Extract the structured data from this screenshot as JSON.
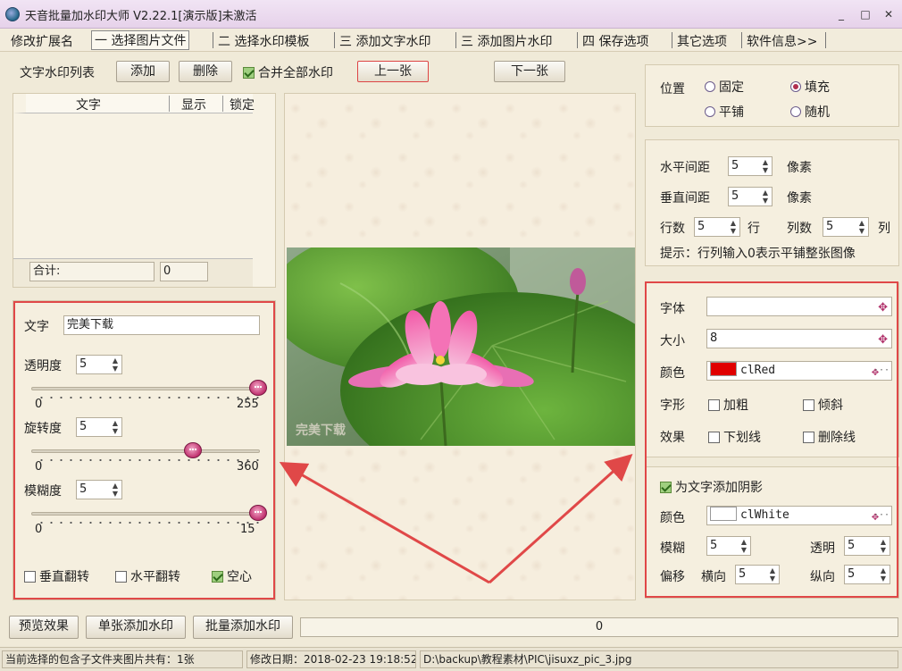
{
  "window": {
    "title": "天音批量加水印大师 V2.22.1[演示版]未激活",
    "controls": [
      "_",
      "□",
      "✕"
    ]
  },
  "menu": {
    "items": [
      "修改扩展名",
      "一 选择图片文件",
      "二 选择水印模板",
      "三 添加文字水印",
      "三 添加图片水印",
      "四 保存选项",
      "其它选项",
      "软件信息>>"
    ],
    "active_index": 1
  },
  "toolbar": {
    "list_label": "文字水印列表",
    "add": "添加",
    "delete": "删除",
    "merge_label": "合并全部水印",
    "prev": "上一张",
    "next": "下一张"
  },
  "list_table": {
    "headers": [
      "文字",
      "显示",
      "锁定"
    ],
    "total_label": "合计:",
    "total_value": "0"
  },
  "text_props": {
    "text_label": "文字",
    "text_value": "完美下载",
    "opacity_label": "透明度",
    "opacity_value": "5",
    "opacity_min": "0",
    "opacity_max": "255",
    "opacity_fraction": 1.0,
    "rotation_label": "旋转度",
    "rotation_value": "5",
    "rotation_min": "0",
    "rotation_max": "360",
    "rotation_fraction": 0.7,
    "blur_label": "模糊度",
    "blur_value": "5",
    "blur_min": "0",
    "blur_max": "15",
    "blur_fraction": 1.0,
    "flip_v": "垂直翻转",
    "flip_h": "水平翻转",
    "hollow": "空心"
  },
  "preview": {
    "watermark_text": "完美下载"
  },
  "position": {
    "label": "位置",
    "fixed": "固定",
    "fill": "填充",
    "tile": "平铺",
    "random": "随机",
    "selected": "fill"
  },
  "spacing": {
    "h_label": "水平间距",
    "h_value": "5",
    "v_label": "垂直间距",
    "v_value": "5",
    "unit": "像素",
    "rows_label": "行数",
    "rows_value": "5",
    "rows_unit": "行",
    "cols_label": "列数",
    "cols_value": "5",
    "cols_unit": "列",
    "hint": "提示：行列输入0表示平铺整张图像"
  },
  "font": {
    "font_label": "字体",
    "font_value": "",
    "size_label": "大小",
    "size_value": "8",
    "color_label": "颜色",
    "color_value": "clRed",
    "color_hex": "#e00000",
    "style_label": "字形",
    "bold": "加粗",
    "italic": "倾斜",
    "effect_label": "效果",
    "underline": "下划线",
    "strike": "删除线"
  },
  "shadow": {
    "enable_label": "为文字添加阴影",
    "color_label": "颜色",
    "color_value": "clWhite",
    "color_hex": "#ffffff",
    "blur_label": "模糊",
    "blur_value": "5",
    "opacity_label": "透明",
    "opacity_value": "5",
    "offset_label": "偏移",
    "offset_h_label": "横向",
    "offset_h_value": "5",
    "offset_v_label": "纵向",
    "offset_v_value": "5"
  },
  "bottom": {
    "preview": "预览效果",
    "single": "单张添加水印",
    "batch": "批量添加水印",
    "progress_text": "0"
  },
  "status": {
    "count": "当前选择的包含子文件夹图片共有：1张",
    "modified": "修改日期：2018-02-23 19:18:52",
    "path": "D:\\backup\\教程素材\\PIC\\jisuxz_pic_3.jpg"
  },
  "colors": {
    "highlight_frame": "#e04848",
    "titlebar": "#e8d6ec",
    "background": "#f0ead8"
  }
}
